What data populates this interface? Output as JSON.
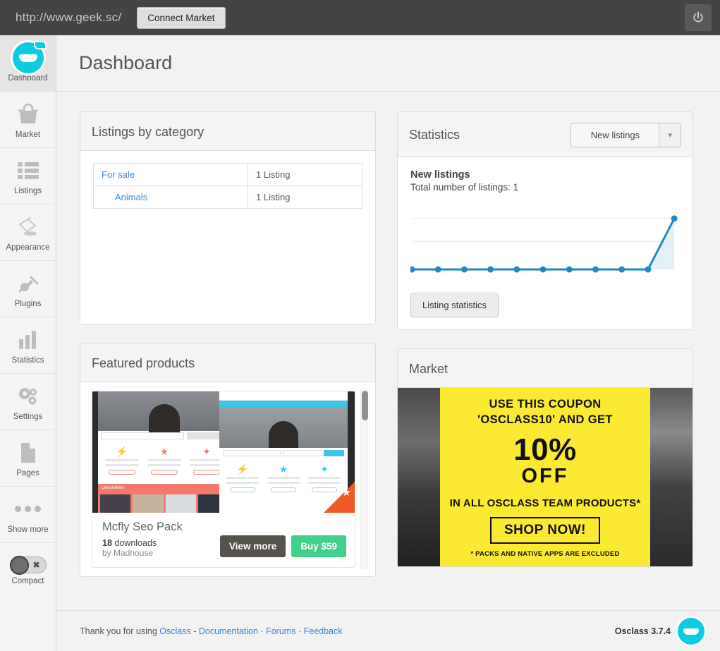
{
  "topbar": {
    "url": "http://www.geek.sc/",
    "connect_label": "Connect Market",
    "logout_icon": "power-icon"
  },
  "sidebar": {
    "items": [
      {
        "label": "Dashboard",
        "icon": "osclass-logo-icon",
        "active": true
      },
      {
        "label": "Market",
        "icon": "shopping-bag-icon",
        "active": false
      },
      {
        "label": "Listings",
        "icon": "list-icon",
        "active": false
      },
      {
        "label": "Appearance",
        "icon": "paint-bucket-icon",
        "active": false
      },
      {
        "label": "Plugins",
        "icon": "plug-icon",
        "active": false
      },
      {
        "label": "Statistics",
        "icon": "bar-chart-icon",
        "active": false
      },
      {
        "label": "Settings",
        "icon": "gears-icon",
        "active": false
      },
      {
        "label": "Pages",
        "icon": "page-icon",
        "active": false
      },
      {
        "label": "Show more",
        "icon": "ellipsis-icon",
        "active": false
      }
    ],
    "compact": {
      "label": "Compact",
      "state": "off",
      "icon": "toggle-off-icon"
    }
  },
  "page": {
    "title": "Dashboard"
  },
  "listings_by_category": {
    "title": "Listings by category",
    "rows": [
      {
        "category": "For sale",
        "count": "1 Listing",
        "child": false
      },
      {
        "category": "Animals",
        "count": "1 Listing",
        "child": true
      }
    ]
  },
  "statistics": {
    "title": "Statistics",
    "dropdown": {
      "selected": "New listings",
      "arrow_icon": "chevron-down-icon"
    },
    "heading": "New listings",
    "subtitle": "Total number of listings: 1",
    "button_label": "Listing statistics",
    "line_color": "#1e87c8",
    "fill_color": "#e4f0f8"
  },
  "chart_data": {
    "type": "line",
    "title": "New listings",
    "xlabel": "",
    "ylabel": "",
    "x": [
      1,
      2,
      3,
      4,
      5,
      6,
      7,
      8,
      9,
      10,
      11
    ],
    "values": [
      0,
      0,
      0,
      0,
      0,
      0,
      0,
      0,
      0,
      0,
      1
    ],
    "series": [
      {
        "name": "New listings",
        "values": [
          0,
          0,
          0,
          0,
          0,
          0,
          0,
          0,
          0,
          0,
          1
        ]
      }
    ],
    "ylim": [
      0,
      1.15
    ],
    "grid": true,
    "gridlines": [
      0.55,
      1.0
    ],
    "legend": "none",
    "markers": true,
    "area_fill": true
  },
  "featured_products": {
    "title": "Featured products",
    "product": {
      "name": "Mcfly Seo Pack",
      "downloads": "18 downloads",
      "downloads_count": "18",
      "downloads_word": "downloads",
      "author": "by Madhouse",
      "view_label": "View more",
      "buy_label": "Buy $59",
      "badge_icon": "star-ribbon-icon",
      "thumbnail": "product-screenshot-collage"
    },
    "scrollbar": "vertical-scrollbar"
  },
  "market": {
    "title": "Market",
    "banner": {
      "line1": "USE THIS COUPON",
      "line2": "'OSCLASS10' AND GET",
      "percent": "10%",
      "off": "OFF",
      "line3": "IN ALL OSCLASS TEAM PRODUCTS*",
      "cta": "SHOP NOW!",
      "fineprint": "* PACKS AND NATIVE APPS ARE EXCLUDED",
      "background_color": "#fbe932"
    }
  },
  "footer": {
    "thanks": "Thank you for using",
    "osclass_link": "Osclass",
    "dash": "-",
    "documentation_link": "Documentation",
    "sep1": "·",
    "forums_link": "Forums",
    "sep2": "·",
    "feedback_link": "Feedback",
    "version": "Osclass 3.7.4",
    "logo_icon": "osclass-logo-icon"
  }
}
